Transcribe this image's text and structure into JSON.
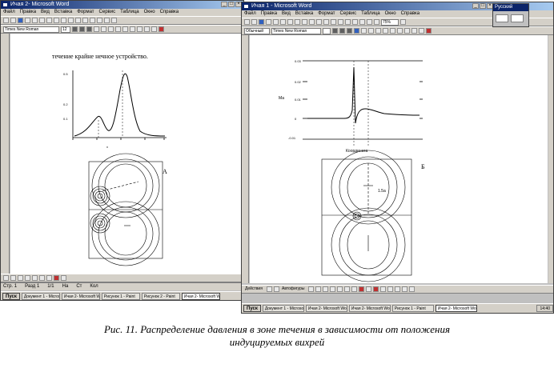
{
  "left_window": {
    "title": "Ичая 2- Microsoft Word",
    "menu": [
      "Файл",
      "Правка",
      "Вид",
      "Вставка",
      "Формат",
      "Сервис",
      "Таблица",
      "Окно",
      "Справка"
    ],
    "font_name": "Times New Roman",
    "font_size": "12",
    "page_heading": "течение крайне нечное устройство.",
    "figure_label": "А",
    "status": [
      "Стр. 1",
      "Разд 1",
      "1/1",
      "На",
      "Ст",
      "Кол"
    ]
  },
  "right_window": {
    "title": "Ичая 1 - Microsoft Word",
    "menu": [
      "Файл",
      "Правка",
      "Вид",
      "Вставка",
      "Формат",
      "Сервис",
      "Таблица",
      "Окно",
      "Справка"
    ],
    "style_name": "Обычный",
    "font_name": "Times New Roman",
    "zoom": "75%",
    "figure_label": "Б",
    "xaxis_label": "Координата",
    "plot_label": "Ма",
    "contour_label": "1.5а",
    "status": [
      "Действия",
      "Автофигуры"
    ]
  },
  "lang_bar": {
    "label": "Русский"
  },
  "taskbar_left": {
    "start": "Пуск",
    "tasks": [
      "Документ 1 - Microsoft Word",
      "Ичая 2- Microsoft Word",
      "Рисунок 1 - Paint",
      "Рисунок 2 - Paint",
      "Ичая 2- Microsoft Word"
    ]
  },
  "taskbar_right": {
    "start": "Пуск",
    "tasks": [
      "Документ 1 - Microsoft Word",
      "Ичая 2- Microsoft Word",
      "Ичая 2- Microsoft Word",
      "Рисунок 1 - Paint",
      "Ичая 2- Microsoft Word"
    ],
    "clock": "14:40"
  },
  "caption": {
    "line1": "Рис. 11. Распределение давления в зоне течения в зависимости от положения",
    "line2": "индуцируемых вихрей"
  }
}
